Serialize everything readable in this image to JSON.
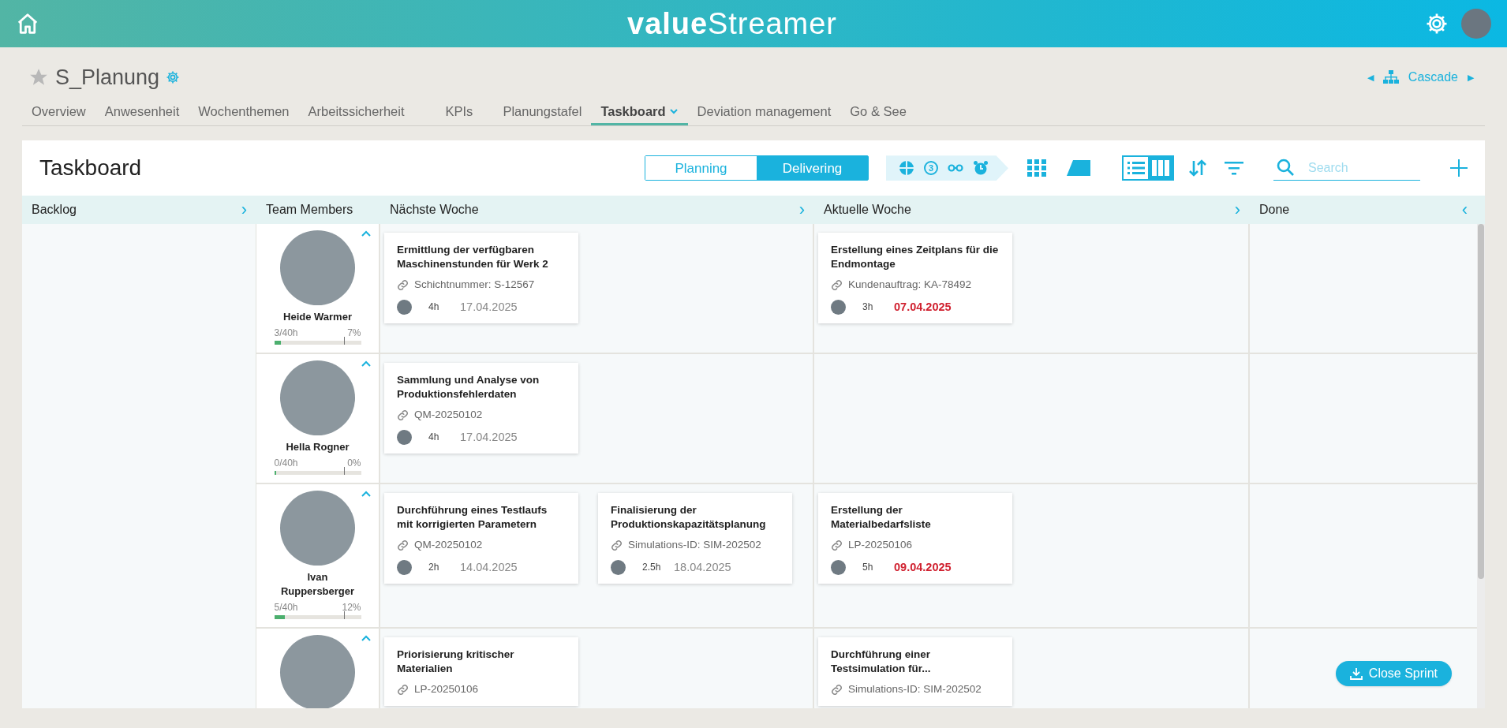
{
  "header": {
    "logo": "**value**Streamer"
  },
  "project": {
    "title": "S_Planung",
    "favorite": false,
    "previous": "◀",
    "cascade": "Cascade",
    "next": "▶"
  },
  "tabs": [
    {
      "label": "Overview",
      "selected": false
    },
    {
      "label": "Anwesenheit",
      "selected": false
    },
    {
      "label": "Wochenthemen",
      "selected": false
    },
    {
      "label": "Arbeitssicherheit",
      "selected": false
    },
    {
      "label": "KPIs",
      "selected": false
    },
    {
      "label": "Planungstafel",
      "selected": false
    },
    {
      "label": "Taskboard",
      "selected": true
    },
    {
      "label": "Deviation management",
      "selected": false
    },
    {
      "label": "Go & See",
      "selected": false
    }
  ],
  "board": {
    "title": "Taskboard",
    "modes": [
      {
        "label": "Planning",
        "selected": false
      },
      {
        "label": "Delivering",
        "selected": true
      }
    ],
    "filter_badge": "3",
    "views": [
      {
        "kind": "list",
        "selected": false
      },
      {
        "kind": "columns",
        "selected": true
      }
    ],
    "search": {
      "placeholder": "Search"
    },
    "columns": [
      {
        "label": "Backlog",
        "arrow": "›"
      },
      {
        "label": "Team Members"
      },
      {
        "label": "Nächste Woche",
        "arrow": "›"
      },
      {
        "label": "Aktuelle Woche",
        "arrow": "›"
      },
      {
        "label": "Done",
        "arrow": "‹"
      }
    ],
    "members": [
      {
        "name": "Heide Warmer",
        "hours": "3/40h",
        "percent": "7%",
        "level": 0.075,
        "next": [
          {
            "title": "Ermittlung der verfügbaren Maschinenstunden für Werk 2",
            "ref": "Schichtnummer: S-12567",
            "effort": "4h",
            "due": "17.04.2025",
            "overdue": false
          }
        ],
        "current": [
          {
            "title": "Erstellung eines Zeitplans für die Endmontage",
            "ref": "Kundenauftrag: KA-78492",
            "effort": "3h",
            "due": "07.04.2025",
            "overdue": true
          }
        ]
      },
      {
        "name": "Hella Rogner",
        "hours": "0/40h",
        "percent": "0%",
        "level": 0,
        "next": [
          {
            "title": "Sammlung und Analyse von Produktionsfehlerdaten",
            "ref": "QM-20250102",
            "effort": "4h",
            "due": "17.04.2025",
            "overdue": false
          }
        ]
      },
      {
        "name": "Ivan Ruppersberger",
        "hours": "5/40h",
        "percent": "12%",
        "level": 0.125,
        "next": [
          {
            "title": "Durchführung eines Testlaufs mit korrigierten Parametern",
            "ref": "QM-20250102",
            "effort": "2h",
            "due": "14.04.2025",
            "overdue": false
          },
          {
            "title": "Finalisierung der Produktionskapazitätsplanung",
            "ref": "Simulations-ID: SIM-202502",
            "effort": "2.5h",
            "due": "18.04.2025",
            "overdue": false
          }
        ],
        "current": [
          {
            "title": "Erstellung der Materialbedarfsliste",
            "ref": "LP-20250106",
            "effort": "5h",
            "due": "09.04.2025",
            "overdue": true
          }
        ]
      },
      {
        "next": [
          {
            "title": "Priorisierung kritischer Materialien",
            "ref": "LP-20250106"
          }
        ],
        "current": [
          {
            "title": "Durchführung einer Testsimulation für...",
            "ref": "Simulations-ID: SIM-202502"
          }
        ]
      }
    ],
    "close_button": "Close Sprint"
  }
}
